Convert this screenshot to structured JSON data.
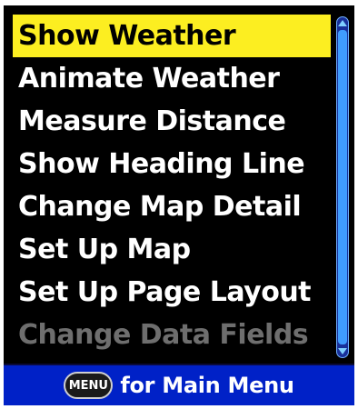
{
  "menu": {
    "items": [
      {
        "label": "Show Weather",
        "state": "selected"
      },
      {
        "label": "Animate Weather",
        "state": "normal"
      },
      {
        "label": "Measure Distance",
        "state": "normal"
      },
      {
        "label": "Show Heading Line",
        "state": "normal"
      },
      {
        "label": "Change Map Detail",
        "state": "normal"
      },
      {
        "label": "Set Up Map",
        "state": "normal"
      },
      {
        "label": "Set Up Page Layout",
        "state": "normal"
      },
      {
        "label": "Change Data Fields",
        "state": "disabled"
      }
    ]
  },
  "footer": {
    "key_label": "MENU",
    "text": "for Main Menu"
  },
  "colors": {
    "background": "#000000",
    "selected_highlight": "#fcee21",
    "footer_bar": "#0021c7",
    "scrollbar": "#3f9cff",
    "disabled_text": "#6e6e6e"
  },
  "icons": {
    "scroll_up": "scroll-up-arrow-icon",
    "scroll_down": "scroll-down-arrow-icon",
    "menu_key": "menu-key-icon"
  }
}
